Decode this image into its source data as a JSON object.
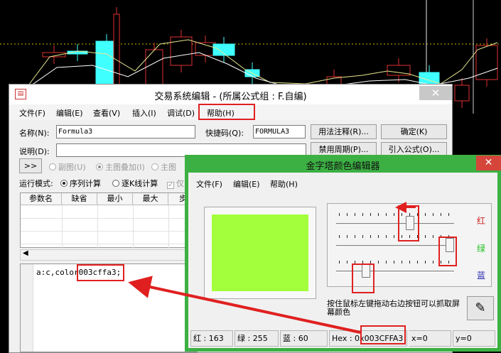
{
  "editor": {
    "title": "交易系统编辑 - (所属公式组 : F.自编)",
    "minimize": "-",
    "close": "✕",
    "menu": [
      "文件(F)",
      "编辑(E)",
      "查看(V)",
      "插入(I)",
      "调试(D)",
      "帮助(H)"
    ],
    "name_label": "名称(N):",
    "name_value": "Formula3",
    "hotkey_label": "快捷码(Q):",
    "hotkey_value": "FORMULA3",
    "desc_label": "说明(D):",
    "desc_value": "",
    "btn_usage": "用法注释(R)...",
    "btn_ok": "确定(K)",
    "btn_period": "禁用周期(P)...",
    "btn_import": "引入公式(O)...",
    "btn_expand": ">>",
    "radio_sub": "副图(U)",
    "radio_overlay": "主图叠加(I)",
    "radio_main": "主图",
    "mode_label": "运行模式:",
    "mode_seq": "序列计算",
    "mode_bar": "逐K线计算",
    "chk_partial": "仅",
    "param_headers": [
      "参数名",
      "缺省",
      "最小",
      "最大",
      "步"
    ],
    "code": "a:c,color003cffa3;"
  },
  "colorEditor": {
    "title": "金字塔颜色编辑器",
    "close": "✕",
    "menu": [
      "文件(F)",
      "编辑(E)",
      "帮助(H)"
    ],
    "swatch_color": "#a3ff3c",
    "channels": [
      {
        "label": "红",
        "color": "#d02020",
        "value": 163
      },
      {
        "label": "绿",
        "color": "#20c020",
        "value": 255
      },
      {
        "label": "蓝",
        "color": "#2020b0",
        "value": 60
      }
    ],
    "hint": "按住鼠标左键拖动右边按钮可以抓取屏幕颜色",
    "status": {
      "red": "红 : 163",
      "green": "绿 : 255",
      "blue": "蓝 : 60",
      "hex_prefix": "Hex : 0x",
      "hex_value": "003CFFA3",
      "x": "x=0",
      "y": "y=0"
    }
  },
  "colors": {
    "highlight": "#e02020",
    "candle_up": "#e03030",
    "candle_down": "#40ffff",
    "line_yellow": "#e8e890",
    "line_white": "#ffffff"
  }
}
